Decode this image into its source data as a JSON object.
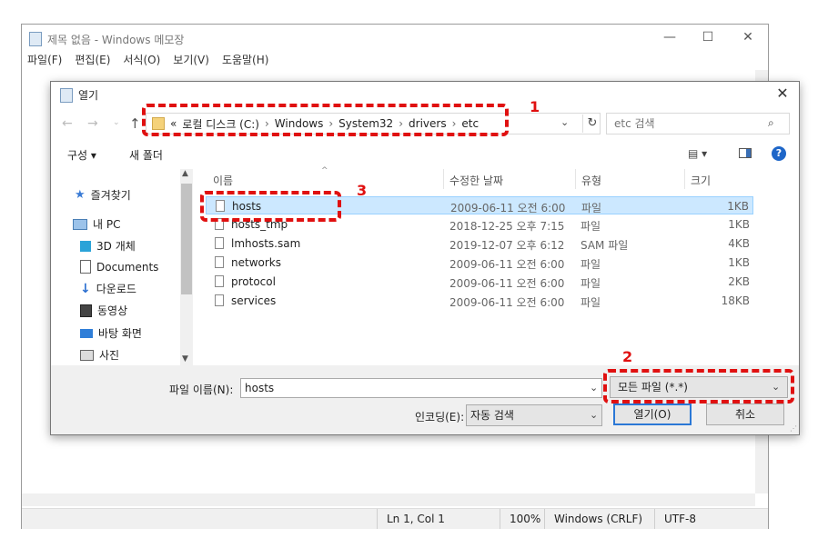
{
  "notepad": {
    "title": "제목 없음 - Windows 메모장",
    "menu": [
      "파일(F)",
      "편집(E)",
      "서식(O)",
      "보기(V)",
      "도움말(H)"
    ],
    "controls": {
      "minimize": "—",
      "maximize": "☐",
      "close": "✕"
    },
    "status": {
      "position": "Ln 1, Col 1",
      "zoom": "100%",
      "line_ending": "Windows (CRLF)",
      "encoding": "UTF-8"
    }
  },
  "dialog": {
    "title": "열기",
    "close": "✕",
    "nav": {
      "back": "←",
      "forward": "→",
      "recent": "⌄",
      "up": "↑"
    },
    "address": {
      "prefix": "«",
      "crumbs": [
        "로컬 디스크 (C:)",
        "Windows",
        "System32",
        "drivers",
        "etc"
      ],
      "separator": "›",
      "dropdown": "⌄",
      "refresh": "↻"
    },
    "search_placeholder": "etc 검색",
    "toolbar": {
      "organize": "구성 ▾",
      "new_folder": "새 폴더",
      "view": "▤ ▾",
      "help": "?"
    },
    "nav_items": [
      {
        "label": "즐겨찾기",
        "icon": "star-icon"
      },
      {
        "label": "내 PC",
        "icon": "computer-icon"
      },
      {
        "label": "3D 개체",
        "icon": "cube-icon"
      },
      {
        "label": "Documents",
        "icon": "document-icon"
      },
      {
        "label": "다운로드",
        "icon": "download-icon"
      },
      {
        "label": "동영상",
        "icon": "video-icon"
      },
      {
        "label": "바탕 화면",
        "icon": "desktop-icon"
      },
      {
        "label": "사진",
        "icon": "picture-icon"
      }
    ],
    "columns": [
      "이름",
      "수정한 날짜",
      "유형",
      "크기"
    ],
    "files": [
      {
        "name": "hosts",
        "date": "2009-06-11 오전 6:00",
        "type": "파일",
        "size": "1KB",
        "selected": true
      },
      {
        "name": "hosts_tmp",
        "date": "2018-12-25 오후 7:15",
        "type": "파일",
        "size": "1KB",
        "selected": false
      },
      {
        "name": "lmhosts.sam",
        "date": "2019-12-07 오후 6:12",
        "type": "SAM 파일",
        "size": "4KB",
        "selected": false
      },
      {
        "name": "networks",
        "date": "2009-06-11 오전 6:00",
        "type": "파일",
        "size": "1KB",
        "selected": false
      },
      {
        "name": "protocol",
        "date": "2009-06-11 오전 6:00",
        "type": "파일",
        "size": "2KB",
        "selected": false
      },
      {
        "name": "services",
        "date": "2009-06-11 오전 6:00",
        "type": "파일",
        "size": "18KB",
        "selected": false
      }
    ],
    "filename_label": "파일 이름(N):",
    "filename_value": "hosts",
    "filetype_value": "모든 파일 (*.*)",
    "encoding_label": "인코딩(E):",
    "encoding_value": "자동 검색",
    "open_button": "열기(O)",
    "cancel_button": "취소"
  },
  "annotations": {
    "n1": "1",
    "n2": "2",
    "n3": "3"
  },
  "colors": {
    "annotation": "#e01010",
    "selection": "#cce8ff",
    "accent": "#2b78d6"
  }
}
